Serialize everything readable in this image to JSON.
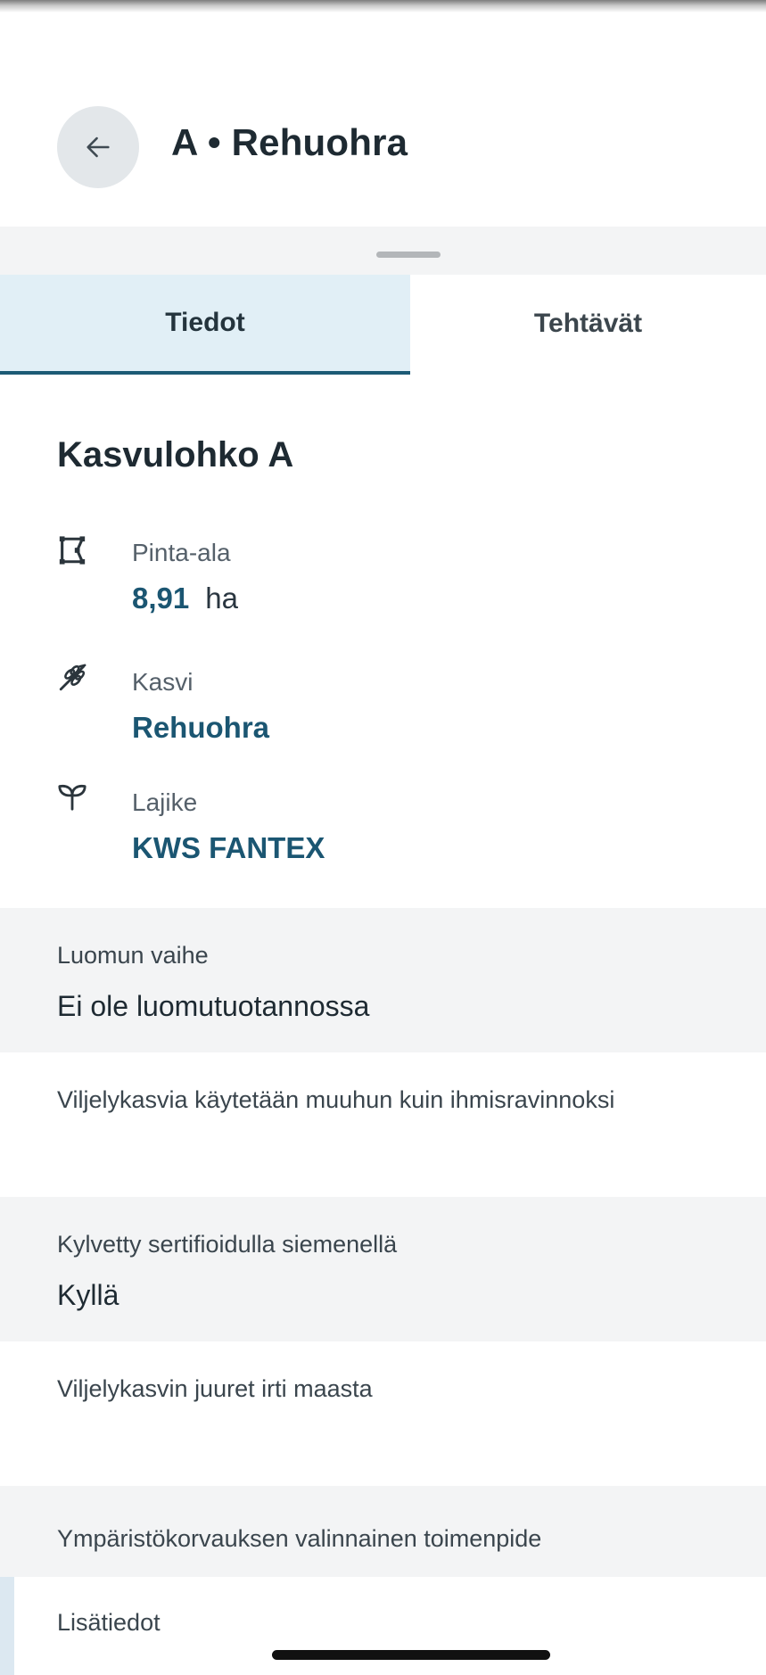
{
  "header": {
    "back_icon": "arrow-left-icon",
    "title": "A • Rehuohra"
  },
  "tabs": [
    {
      "label": "Tiedot",
      "active": true
    },
    {
      "label": "Tehtävät",
      "active": false
    }
  ],
  "details": {
    "title": "Kasvulohko A",
    "area": {
      "icon": "area-polygon-icon",
      "label": "Pinta-ala",
      "value": "8,91",
      "unit": "ha"
    },
    "crop": {
      "icon": "wheat-icon",
      "label": "Kasvi",
      "value": "Rehuohra"
    },
    "variety": {
      "icon": "sprout-icon",
      "label": "Lajike",
      "value": "KWS FANTEX"
    }
  },
  "fields": [
    {
      "label": "Luomun vaihe",
      "value": "Ei ole luomutuotannossa"
    },
    {
      "label": "Viljelykasvia käytetään muuhun kuin ihmisravinnoksi",
      "value": ""
    },
    {
      "label": "Kylvetty sertifioidulla siemenellä",
      "value": "Kyllä"
    },
    {
      "label": "Viljelykasvin juuret irti maasta",
      "value": ""
    },
    {
      "label": "Ympäristökorvauksen valinnainen toimenpide",
      "value": ""
    },
    {
      "label": "Lisätiedot",
      "value": ""
    }
  ],
  "colors": {
    "accent": "#1c5a75",
    "active_tab_bg": "#e1eff6",
    "field_grey": "#f3f4f5"
  }
}
